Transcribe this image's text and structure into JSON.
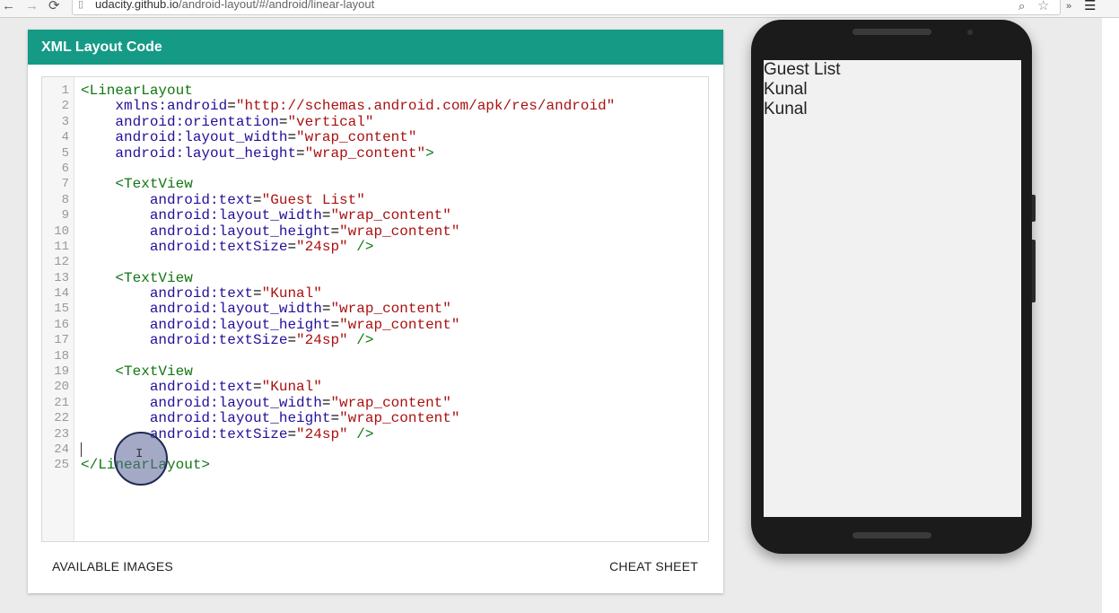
{
  "browser": {
    "back_icon": "←",
    "forward_icon": "→",
    "reload_icon": "⟳",
    "url_domain": "udacity.github.io",
    "url_path": "/android-layout/#/android/linear-layout"
  },
  "editor_card": {
    "title": "XML Layout Code",
    "footer_left": "AVAILABLE IMAGES",
    "footer_right": "CHEAT SHEET"
  },
  "code_lines": [
    {
      "n": "1",
      "tokens": [
        [
          "tag",
          "<LinearLayout"
        ]
      ]
    },
    {
      "n": "2",
      "tokens": [
        [
          "attr",
          "    xmlns:android"
        ],
        [
          "plain",
          "="
        ],
        [
          "str",
          "\"http://schemas.android.com/apk/res/android\""
        ]
      ]
    },
    {
      "n": "3",
      "tokens": [
        [
          "attr",
          "    android:orientation"
        ],
        [
          "plain",
          "="
        ],
        [
          "str",
          "\"vertical\""
        ]
      ]
    },
    {
      "n": "4",
      "tokens": [
        [
          "attr",
          "    android:layout_width"
        ],
        [
          "plain",
          "="
        ],
        [
          "str",
          "\"wrap_content\""
        ]
      ]
    },
    {
      "n": "5",
      "tokens": [
        [
          "attr",
          "    android:layout_height"
        ],
        [
          "plain",
          "="
        ],
        [
          "str",
          "\"wrap_content\""
        ],
        [
          "tag",
          ">"
        ]
      ]
    },
    {
      "n": "6",
      "tokens": []
    },
    {
      "n": "7",
      "tokens": [
        [
          "tag",
          "    <TextView"
        ]
      ]
    },
    {
      "n": "8",
      "tokens": [
        [
          "attr",
          "        android:text"
        ],
        [
          "plain",
          "="
        ],
        [
          "str",
          "\"Guest List\""
        ]
      ]
    },
    {
      "n": "9",
      "tokens": [
        [
          "attr",
          "        android:layout_width"
        ],
        [
          "plain",
          "="
        ],
        [
          "str",
          "\"wrap_content\""
        ]
      ]
    },
    {
      "n": "10",
      "tokens": [
        [
          "attr",
          "        android:layout_height"
        ],
        [
          "plain",
          "="
        ],
        [
          "str",
          "\"wrap_content\""
        ]
      ]
    },
    {
      "n": "11",
      "tokens": [
        [
          "attr",
          "        android:textSize"
        ],
        [
          "plain",
          "="
        ],
        [
          "str",
          "\"24sp\""
        ],
        [
          "tag",
          " />"
        ]
      ]
    },
    {
      "n": "12",
      "tokens": []
    },
    {
      "n": "13",
      "tokens": [
        [
          "tag",
          "    <TextView"
        ]
      ]
    },
    {
      "n": "14",
      "tokens": [
        [
          "attr",
          "        android:text"
        ],
        [
          "plain",
          "="
        ],
        [
          "str",
          "\"Kunal\""
        ]
      ]
    },
    {
      "n": "15",
      "tokens": [
        [
          "attr",
          "        android:layout_width"
        ],
        [
          "plain",
          "="
        ],
        [
          "str",
          "\"wrap_content\""
        ]
      ]
    },
    {
      "n": "16",
      "tokens": [
        [
          "attr",
          "        android:layout_height"
        ],
        [
          "plain",
          "="
        ],
        [
          "str",
          "\"wrap_content\""
        ]
      ]
    },
    {
      "n": "17",
      "tokens": [
        [
          "attr",
          "        android:textSize"
        ],
        [
          "plain",
          "="
        ],
        [
          "str",
          "\"24sp\""
        ],
        [
          "tag",
          " />"
        ]
      ]
    },
    {
      "n": "18",
      "tokens": []
    },
    {
      "n": "19",
      "tokens": [
        [
          "tag",
          "    <TextView"
        ]
      ]
    },
    {
      "n": "20",
      "tokens": [
        [
          "attr",
          "        android:text"
        ],
        [
          "plain",
          "="
        ],
        [
          "str",
          "\"Kunal\""
        ]
      ]
    },
    {
      "n": "21",
      "tokens": [
        [
          "attr",
          "        android:layout_width"
        ],
        [
          "plain",
          "="
        ],
        [
          "str",
          "\"wrap_content\""
        ]
      ]
    },
    {
      "n": "22",
      "tokens": [
        [
          "attr",
          "        android:layout_height"
        ],
        [
          "plain",
          "="
        ],
        [
          "str",
          "\"wrap_content\""
        ]
      ]
    },
    {
      "n": "23",
      "tokens": [
        [
          "attr",
          "        android:textSize"
        ],
        [
          "plain",
          "="
        ],
        [
          "str",
          "\"24sp\""
        ],
        [
          "tag",
          " />"
        ]
      ]
    },
    {
      "n": "24",
      "tokens": []
    },
    {
      "n": "25",
      "tokens": [
        [
          "tag",
          "</LinearLayout>"
        ]
      ]
    }
  ],
  "phone_screen": {
    "items": [
      "Guest List",
      "Kunal",
      "Kunal"
    ]
  },
  "colors": {
    "header_teal": "#159a85",
    "tag_green": "#117711",
    "attr_blue": "#221199",
    "string_red": "#aa1111"
  }
}
